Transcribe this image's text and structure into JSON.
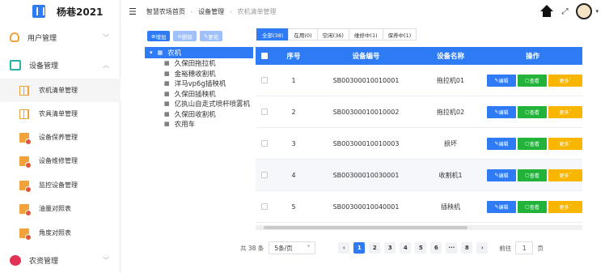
{
  "app": {
    "name": "杨巷2021"
  },
  "topbar": {
    "breadcrumb": [
      "智慧农场首页",
      "设备管理",
      "农机清单管理"
    ]
  },
  "sidebar": {
    "user_mgmt": "用户管理",
    "device_mgmt": "设备管理",
    "items": [
      {
        "label": "农机清单管理"
      },
      {
        "label": "农具清单管理"
      },
      {
        "label": "设备保养管理"
      },
      {
        "label": "设备维修管理"
      },
      {
        "label": "监控设备管理"
      },
      {
        "label": "油量对照表"
      },
      {
        "label": "角度对照表"
      }
    ],
    "farm_mgmt": "农资管理"
  },
  "tree_toolbar": {
    "add": "增加",
    "delete": "删除",
    "edit": "更名"
  },
  "tree": {
    "root": "农机",
    "children": [
      "久保田拖拉机",
      "金裕穗收割机",
      "洋马vp6g插秧机",
      "久保田插秧机",
      "亿执山自走式喷杆喷雾机",
      "久保田收割机",
      "农用车"
    ]
  },
  "tabs": [
    "全部(38)",
    "在用(0)",
    "空闲(36)",
    "维修中(1)",
    "保养中(1)"
  ],
  "table": {
    "headers": {
      "index": "序号",
      "code": "设备编号",
      "name": "设备名称",
      "ops": "操作"
    },
    "rows": [
      {
        "index": "1",
        "code": "SB00300010010001",
        "name": "拖拉机01"
      },
      {
        "index": "2",
        "code": "SB00300010010002",
        "name": "拖拉机02"
      },
      {
        "index": "3",
        "code": "SB00300010010003",
        "name": "损坏"
      },
      {
        "index": "4",
        "code": "SB00300010030001",
        "name": "收割机1"
      },
      {
        "index": "5",
        "code": "SB00300010040001",
        "name": "插秧机"
      }
    ],
    "op_labels": {
      "edit": "编辑",
      "view": "查看",
      "more": "更多"
    }
  },
  "pager": {
    "total": "共 38 条",
    "page_size": "5条/页",
    "pages": [
      "1",
      "2",
      "3",
      "4",
      "5",
      "6",
      "···",
      "8"
    ],
    "goto_label": "前往",
    "goto_value": "1",
    "page_unit": "页"
  },
  "colors": {
    "primary": "#2f7bf5",
    "success": "#23b33b",
    "warning": "#f9b600"
  }
}
